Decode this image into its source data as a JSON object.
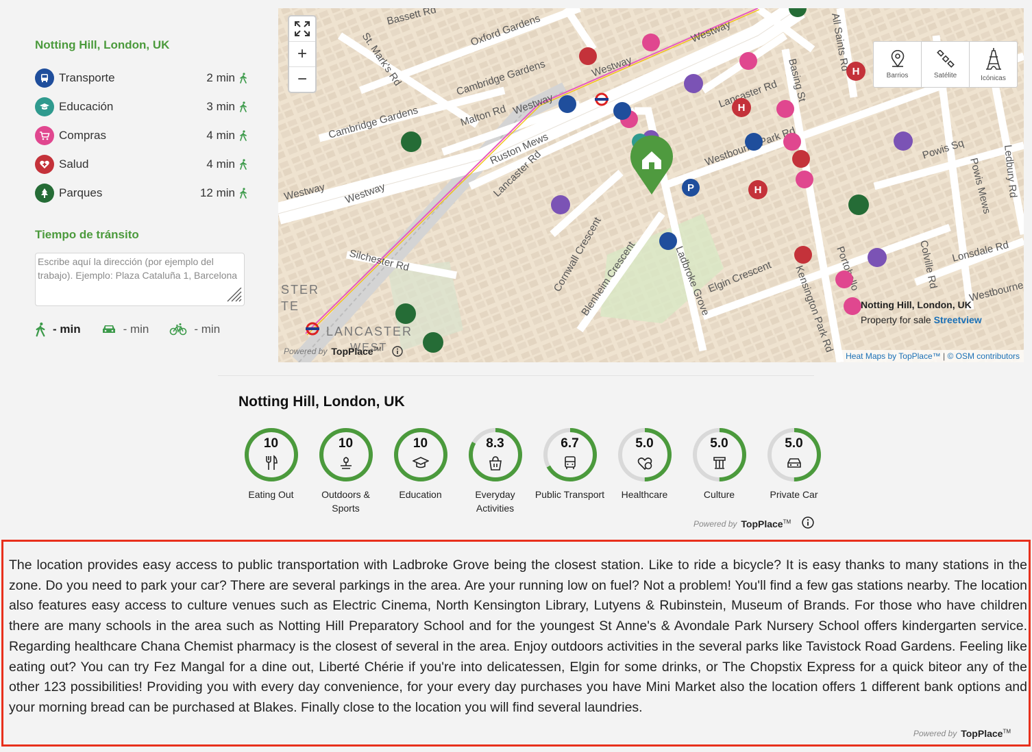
{
  "sidebar": {
    "location": "Notting Hill, London, UK",
    "pois": [
      {
        "label": "Transporte",
        "time": "2 min",
        "color": "#1f4e9c",
        "icon": "bus-icon"
      },
      {
        "label": "Educación",
        "time": "3 min",
        "color": "#2f9a8e",
        "icon": "graduation-cap-icon"
      },
      {
        "label": "Compras",
        "time": "4 min",
        "color": "#e0478f",
        "icon": "shopping-cart-icon"
      },
      {
        "label": "Salud",
        "time": "4 min",
        "color": "#c4323a",
        "icon": "health-heart-icon"
      },
      {
        "label": "Parques",
        "time": "12 min",
        "color": "#256c36",
        "icon": "tree-icon"
      }
    ],
    "transit_title": "Tiempo de tránsito",
    "address_placeholder": "Escribe aquí la dirección (por ejemplo del trabajo). Ejemplo: Plaza Cataluña 1, Barcelona",
    "transit": {
      "walk": "- min",
      "car": "- min",
      "bike": "- min"
    }
  },
  "map": {
    "zoom_in": "+",
    "zoom_out": "−",
    "layers": [
      {
        "label": "Barrios",
        "icon": "location-pin-icon"
      },
      {
        "label": "Satélite",
        "icon": "satellite-icon"
      },
      {
        "label": "Icónicas",
        "icon": "eiffel-tower-icon"
      }
    ],
    "streets": [
      "Westway",
      "Westway",
      "Westway",
      "Westway",
      "Westway",
      "Cambridge Gardens",
      "Cambridge Gardens",
      "Oxford Gardens",
      "Bassett Rd",
      "St. Mark's Rd",
      "Malton Rd",
      "Ruston Mews",
      "Lancaster Rd",
      "Lancaster Rd",
      "Westbourne Park Rd",
      "Silchester Rd",
      "Cornwall Crescent",
      "Blenheim Crescent",
      "Ladbroke Grove",
      "Elgin Crescent",
      "Kensington Park Rd",
      "All Saints Rd",
      "Basing St",
      "Powis Sq",
      "Powis Mews",
      "Ledbury Rd",
      "Colville Rd",
      "Lonsdale Rd",
      "Westbourne",
      "Portobello",
      "LANCASTER",
      "WEST",
      "STER",
      "TE"
    ],
    "popup_title": "Notting Hill, London, UK",
    "popup_sub": "Property for sale",
    "popup_link": "Streetview",
    "attr_prefix": "Heat Maps by TopPlace™",
    "attr_sep": " | ",
    "attr_osm": "© OSM contributors",
    "powered": "Powered by",
    "brand": "TopPlace",
    "tm": "TM"
  },
  "scores": {
    "title": "Notting Hill, London, UK",
    "items": [
      {
        "value": "10",
        "label": "Eating Out",
        "fraction": 1.0,
        "icon": "fork-knife-icon"
      },
      {
        "value": "10",
        "label": "Outdoors & Sports",
        "fraction": 1.0,
        "icon": "outdoors-icon"
      },
      {
        "value": "10",
        "label": "Education",
        "fraction": 1.0,
        "icon": "graduation-cap-icon"
      },
      {
        "value": "8.3",
        "label": "Everyday Activities",
        "fraction": 0.83,
        "icon": "basket-icon"
      },
      {
        "value": "6.7",
        "label": "Public Transport",
        "fraction": 0.67,
        "icon": "bus-icon"
      },
      {
        "value": "5.0",
        "label": "Healthcare",
        "fraction": 0.5,
        "icon": "health-heart-icon"
      },
      {
        "value": "5.0",
        "label": "Culture",
        "fraction": 0.5,
        "icon": "culture-icon"
      },
      {
        "value": "5.0",
        "label": "Private Car",
        "fraction": 0.5,
        "icon": "car-icon"
      }
    ],
    "powered": "Powered by",
    "brand": "TopPlace",
    "tm": "TM"
  },
  "description": {
    "text": "The location provides easy access to public transportation with Ladbroke Grove being the closest station. Like to ride a bicycle? It is easy thanks to many stations in the zone. Do you need to park your car? There are several parkings in the area. Are your running low on fuel? Not a problem! You'll find a few gas stations nearby. The location also features easy access to culture venues such as Electric Cinema, North Kensington Library, Lutyens & Rubinstein, Museum of Brands. For those who have children there are many schools in the area such as Notting Hill Preparatory School and for the youngest St Anne's & Avondale Park Nursery School offers kindergarten service. Regarding healthcare Chana Chemist pharmacy is the closest of several in the area. Enjoy outdoors activities in the several parks like Tavistock Road Gardens. Feeling like eating out? You can try Fez Mangal for a dine out, Liberté Chérie if you're into delicatessen, Elgin for some drinks, or The Chopstix Express for a quick biteor any of the other 123 possibilities! Providing you with every day convenience, for your every day purchases you have Mini Market also the location offers 1 different bank options and your morning bread can be purchased at Blakes. Finally close to the location you will find several laundries.",
    "powered": "Powered by",
    "brand": "TopPlace",
    "tm": "TM"
  },
  "colors": {
    "accent_green": "#4b9a3c",
    "ring_green": "#4b9a3c",
    "highlight_border": "#e8301c"
  }
}
